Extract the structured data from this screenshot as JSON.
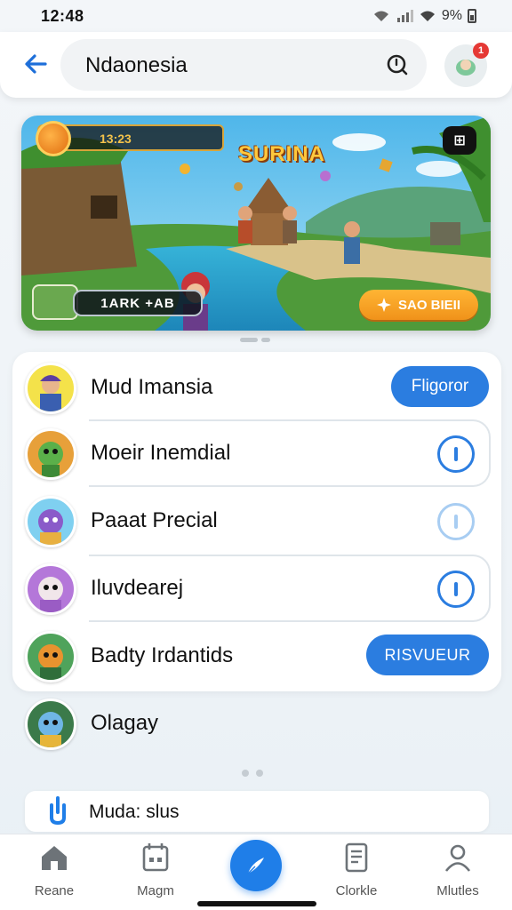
{
  "status_bar": {
    "time": "12:48",
    "battery": "9%"
  },
  "header": {
    "search_value": "Ndaonesia",
    "notification_count": "1"
  },
  "banner": {
    "hud_value": "13:23",
    "game_title": "SURINA",
    "player_name": "1ARK +AB",
    "cta_label": "SAO BIEII",
    "share_label": "⊞"
  },
  "list": {
    "items": [
      {
        "name": "Mud Imansia",
        "action": "Fligoror",
        "action_type": "button"
      },
      {
        "name": "Moeir Inemdial",
        "action_type": "ring"
      },
      {
        "name": "Paaat Precial",
        "action_type": "ring-faint"
      },
      {
        "name": "Iluvdearej",
        "action_type": "ring"
      },
      {
        "name": "Badty Irdantids",
        "action": "RISVUEUR",
        "action_type": "button"
      },
      {
        "name": "Olagay",
        "action_type": "none"
      }
    ]
  },
  "mini_card": {
    "label": "Muda: slus"
  },
  "bottom_nav": {
    "items": [
      {
        "label": "Reane",
        "icon": "home-icon"
      },
      {
        "label": "Magm",
        "icon": "calendar-icon"
      },
      {
        "label": "",
        "icon": "compose-icon"
      },
      {
        "label": "Clorkle",
        "icon": "document-icon"
      },
      {
        "label": "Mlutles",
        "icon": "profile-icon"
      }
    ]
  },
  "colors": {
    "accent": "#2b7de0",
    "cta": "#f0921a",
    "notification": "#e53935"
  }
}
